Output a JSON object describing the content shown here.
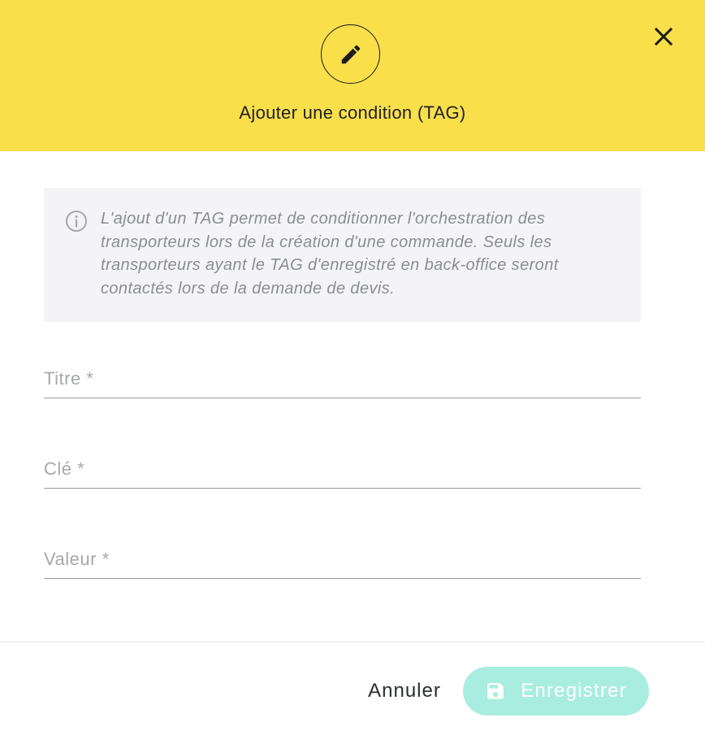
{
  "dialog": {
    "title": "Ajouter une condition (TAG)",
    "header_icon": "pencil-icon",
    "close_icon": "close-icon"
  },
  "info": {
    "icon": "info-icon",
    "text": "L'ajout d'un TAG permet de conditionner l'orchestration des transporteurs lors de la création d'une commande. Seuls les transporteurs ayant le TAG d'enregistré en back-office seront contactés lors de la demande de devis."
  },
  "form": {
    "titre": {
      "label": "Titre *",
      "value": ""
    },
    "cle": {
      "label": "Clé *",
      "value": ""
    },
    "valeur": {
      "label": "Valeur *",
      "value": ""
    }
  },
  "footer": {
    "cancel_label": "Annuler",
    "save_label": "Enregistrer",
    "save_icon": "save-icon"
  },
  "colors": {
    "header_bg": "#f9df4a",
    "info_bg": "#f4f4f6",
    "save_button_bg": "#a8ede0",
    "text_dark": "#1f2126",
    "placeholder": "#a6a8ad"
  }
}
